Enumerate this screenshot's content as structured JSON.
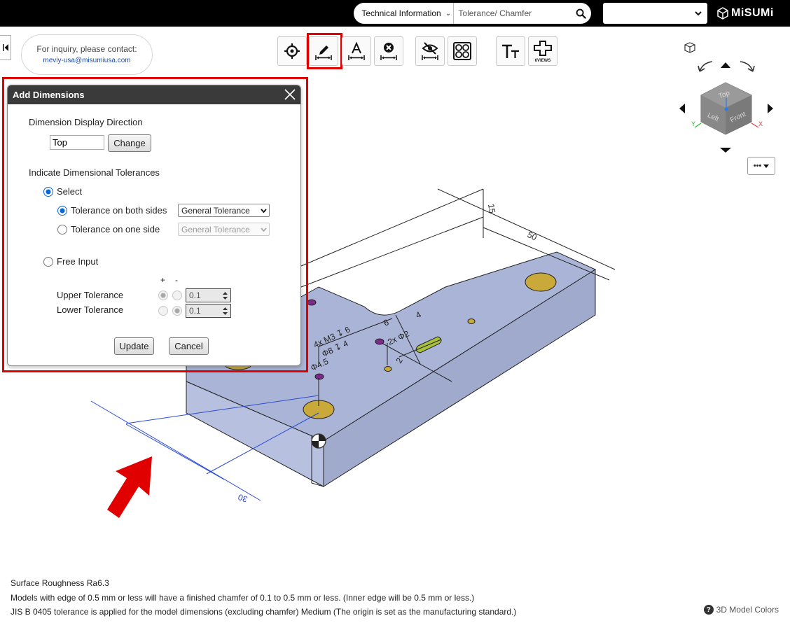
{
  "header": {
    "category_label": "Technical Information",
    "search_value": "Tolerance/ Chamfer",
    "language_value": "",
    "logo_text": "MiSUMi"
  },
  "inquiry": {
    "line1": "For inquiry, please contact:",
    "email": "meviy-usa@misumiusa.com"
  },
  "toolbar": {
    "six_views_label": "6VIEWS",
    "text_tool_label": "TT"
  },
  "viewcube": {
    "faces": [
      "Top",
      "Left",
      "Front"
    ],
    "axes": [
      "Y",
      "X"
    ]
  },
  "more_menu": {
    "label": "•••"
  },
  "model_annotations": {
    "dims": [
      "15",
      "50",
      "30",
      "6",
      "4",
      "2",
      "2",
      "30"
    ],
    "callouts": [
      "4x M3 ↧ 6",
      "Φ8 ↧ 4",
      "Φ4.5",
      "2x Φ2"
    ]
  },
  "dialog": {
    "title": "Add Dimensions",
    "display_direction_label": "Dimension Display Direction",
    "direction_value": "Top",
    "change_button": "Change",
    "tolerance_section_label": "Indicate Dimensional Tolerances",
    "select_label": "Select",
    "both_sides_label": "Tolerance on both sides",
    "both_sides_select": "General Tolerance",
    "one_side_label": "Tolerance on one side",
    "one_side_select": "General Tolerance",
    "free_input_label": "Free Input",
    "plus_label": "+",
    "minus_label": "-",
    "upper_label": "Upper Tolerance",
    "lower_label": "Lower Tolerance",
    "upper_value": "0.1",
    "lower_value": "0.1",
    "update_button": "Update",
    "cancel_button": "Cancel"
  },
  "footer": {
    "line1": "Surface Roughness Ra6.3",
    "line2": "Models with edge of 0.5 mm or less will have a finished chamfer of 0.1 to 0.5 mm or less. (Inner edge will be 0.5 mm or less.)",
    "line3": "JIS B 0405 tolerance is applied for the model dimensions (excluding chamfer) Medium (The origin is set as the manufacturing standard.)",
    "model_colors_label": "3D Model Colors"
  },
  "colors": {
    "model_fill": "#aab4d6",
    "highlight": "#e00000",
    "accent": "#0a66d8",
    "hole": "#c8a93a",
    "hole_purple": "#7a2b8a"
  }
}
